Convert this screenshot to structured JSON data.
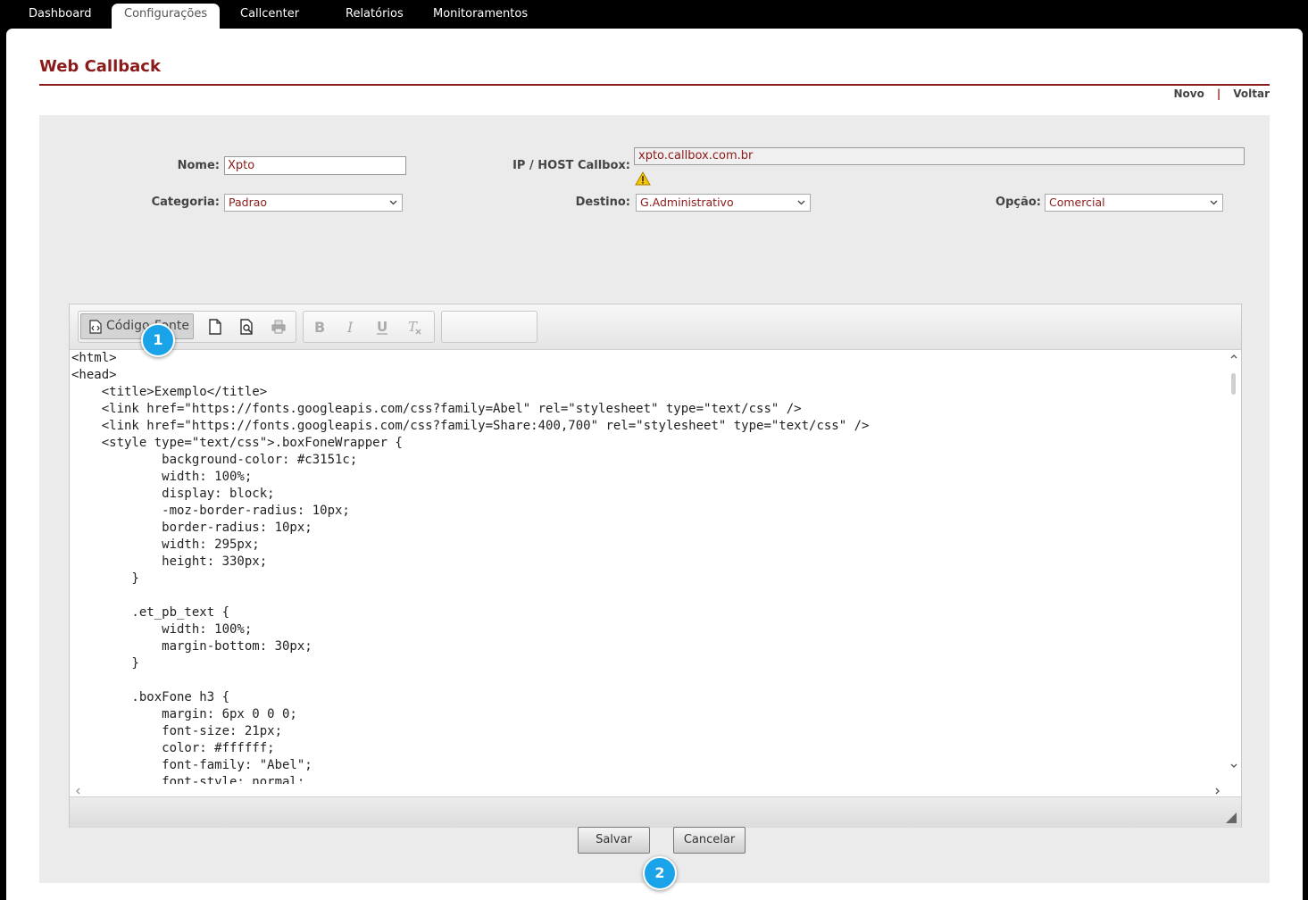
{
  "nav": {
    "tabs": [
      {
        "label": "Dashboard",
        "active": false
      },
      {
        "label": "Configurações",
        "active": true
      },
      {
        "label": "Callcenter",
        "active": false
      },
      {
        "label": "Relatórios",
        "active": false
      },
      {
        "label": "Monitoramentos",
        "active": false
      }
    ]
  },
  "page": {
    "title": "Web Callback",
    "actions": {
      "new": "Novo",
      "separator": "|",
      "back": "Voltar"
    }
  },
  "form": {
    "nome_label": "Nome:",
    "nome_value": "Xpto",
    "host_label": "IP / HOST Callbox:",
    "host_value": "xpto.callbox.com.br",
    "categoria_label": "Categoria:",
    "categoria_value": "Padrao",
    "destino_label": "Destino:",
    "destino_value": "G.Administrativo",
    "opcao_label": "Opção:",
    "opcao_value": "Comercial"
  },
  "editor": {
    "source_button_label": "Código-Fonte",
    "code": "<html>\n<head>\n    <title>Exemplo</title>\n    <link href=\"https://fonts.googleapis.com/css?family=Abel\" rel=\"stylesheet\" type=\"text/css\" />\n    <link href=\"https://fonts.googleapis.com/css?family=Share:400,700\" rel=\"stylesheet\" type=\"text/css\" />\n    <style type=\"text/css\">.boxFoneWrapper {\n            background-color: #c3151c;\n            width: 100%;\n            display: block;\n            -moz-border-radius: 10px;\n            border-radius: 10px;\n            width: 295px;\n            height: 330px;\n        }\n\n        .et_pb_text {\n            width: 100%;\n            margin-bottom: 30px;\n        }\n\n        .boxFone h3 {\n            margin: 6px 0 0 0;\n            font-size: 21px;\n            color: #ffffff;\n            font-family: \"Abel\";\n            font-style: normal;"
  },
  "buttons": {
    "save": "Salvar",
    "cancel": "Cancelar"
  },
  "badges": {
    "one": "1",
    "two": "2"
  },
  "colors": {
    "accent": "#8b1a1a",
    "badge": "#1aa3e8",
    "panel": "#ebebeb"
  }
}
